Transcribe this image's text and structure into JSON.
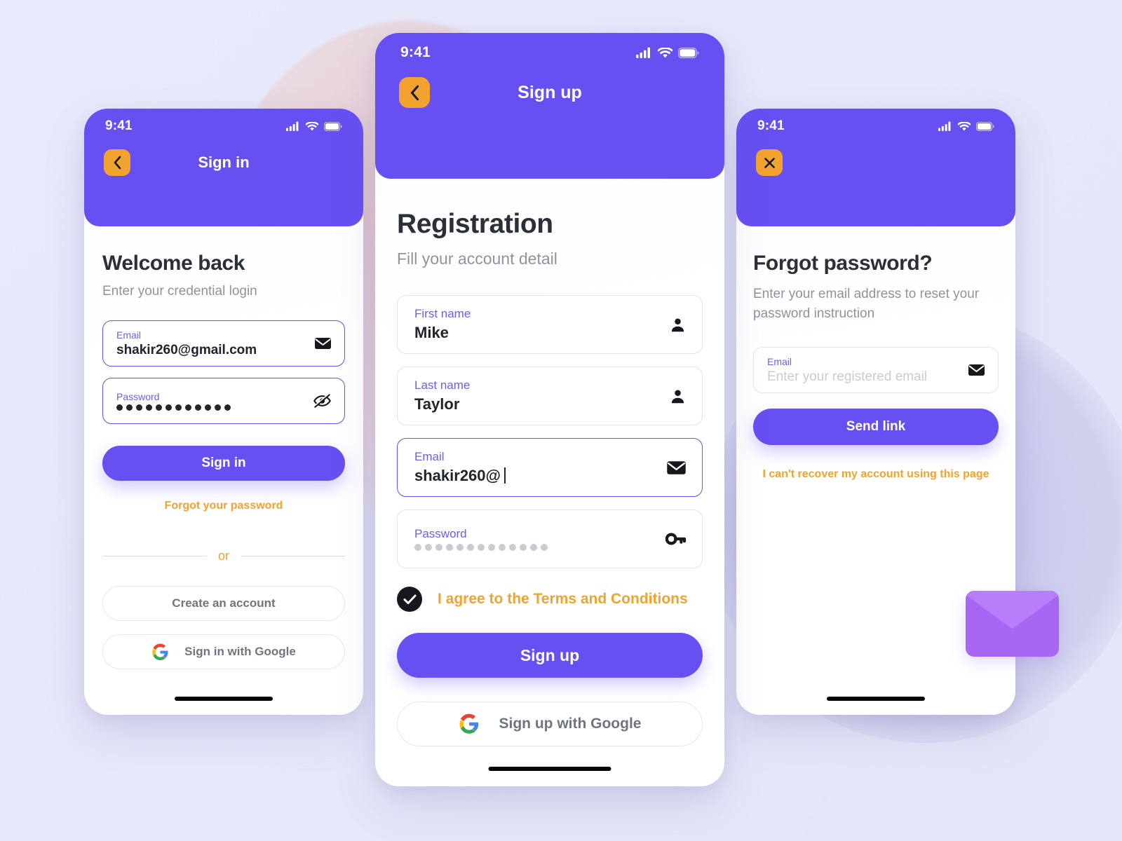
{
  "theme": {
    "primary": "#6750f2",
    "accent_orange": "#f2a22e",
    "text_dark": "#2b2f38",
    "text_muted": "#8e939d",
    "background": "#e6e8fa",
    "envelope": "#a866f5"
  },
  "screens": [
    {
      "id": "signin",
      "status_bar": {
        "time": "9:41",
        "signal": "signal-icon",
        "wifi": "wifi-icon",
        "battery": "battery-icon"
      },
      "nav": {
        "button_icon": "chevron-left-icon",
        "title": "Sign in"
      },
      "heading": "Welcome back",
      "subheading": "Enter your credential login",
      "fields": [
        {
          "label": "Email",
          "value": "shakir260@gmail.com",
          "icon": "envelope-icon",
          "active": true,
          "type": "text"
        },
        {
          "label": "Password",
          "value": "••••••••••••",
          "icon": "eye-off-icon",
          "active": true,
          "type": "password",
          "dots": 12
        }
      ],
      "primary_button": "Sign in",
      "forgot_link": "Forgot your password",
      "divider_label": "or",
      "secondary_buttons": [
        {
          "label": "Create an account",
          "icon": null
        },
        {
          "label": "Sign in with Google",
          "icon": "google-icon"
        }
      ]
    },
    {
      "id": "signup",
      "status_bar": {
        "time": "9:41",
        "signal": "signal-icon",
        "wifi": "wifi-icon",
        "battery": "battery-icon"
      },
      "nav": {
        "button_icon": "chevron-left-icon",
        "title": "Sign up"
      },
      "heading": "Registration",
      "subheading": "Fill your account detail",
      "fields": [
        {
          "label": "First name",
          "value": "Mike",
          "icon": "person-icon",
          "active": false,
          "type": "text"
        },
        {
          "label": "Last name",
          "value": "Taylor",
          "icon": "person-icon",
          "active": false,
          "type": "text"
        },
        {
          "label": "Email",
          "value": "shakir260@",
          "icon": "envelope-icon",
          "active": true,
          "type": "text",
          "caret": true
        },
        {
          "label": "Password",
          "value": "••••••••••••",
          "icon": "key-icon",
          "active": false,
          "type": "password",
          "dots": 13
        }
      ],
      "terms": {
        "label": "I agree to the Terms and Conditions",
        "checked": true,
        "check_icon": "check-icon"
      },
      "primary_button": "Sign up",
      "secondary_buttons": [
        {
          "label": "Sign up with Google",
          "icon": "google-icon"
        }
      ]
    },
    {
      "id": "forgot",
      "status_bar": {
        "time": "9:41",
        "signal": "signal-icon",
        "wifi": "wifi-icon",
        "battery": "battery-icon"
      },
      "nav": {
        "button_icon": "close-icon",
        "title": ""
      },
      "heading": "Forgot password?",
      "subheading": "Enter your email address to reset your password instruction",
      "fields": [
        {
          "label": "Email",
          "value": "",
          "placeholder": "Enter your registered email",
          "icon": "envelope-icon",
          "active": false,
          "type": "text"
        }
      ],
      "primary_button": "Send link",
      "recover_link": "I can't recover my account using this page"
    }
  ],
  "decorations": {
    "envelope_illustration": "envelope-illustration",
    "pink_blob": "pink-blob",
    "violet_blob": "violet-blob"
  }
}
